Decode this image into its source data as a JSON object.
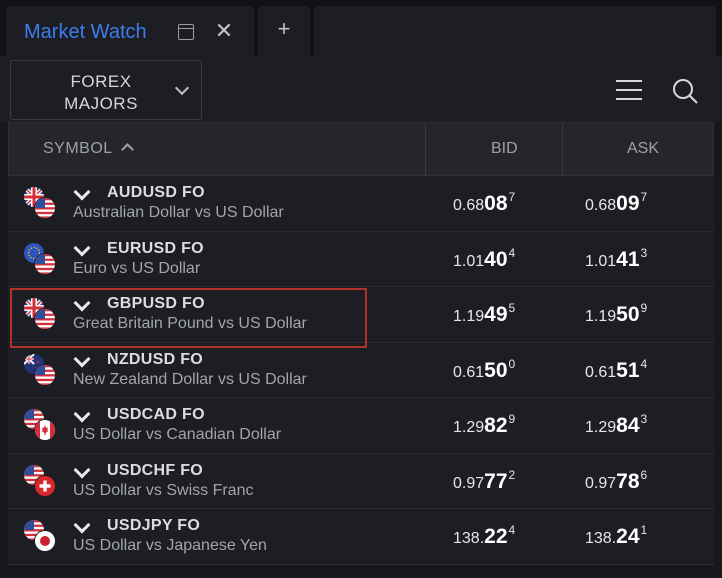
{
  "tabs": {
    "active_title": "Market Watch",
    "add_label": "+"
  },
  "toolbar": {
    "dropdown_line1": "FOREX",
    "dropdown_line2": "MAJORS"
  },
  "table": {
    "headers": {
      "symbol": "SYMBOL",
      "bid": "BID",
      "ask": "ASK"
    },
    "rows": [
      {
        "symbol": "AUDUSD FO",
        "description": "Australian Dollar vs US Dollar",
        "bid": {
          "pre": "0.68",
          "big": "08",
          "sup": "7"
        },
        "ask": {
          "pre": "0.68",
          "big": "09",
          "sup": "7"
        },
        "flags": [
          "uk",
          "us"
        ]
      },
      {
        "symbol": "EURUSD FO",
        "description": "Euro vs US Dollar",
        "bid": {
          "pre": "1.01",
          "big": "40",
          "sup": "4"
        },
        "ask": {
          "pre": "1.01",
          "big": "41",
          "sup": "3"
        },
        "flags": [
          "eu",
          "us"
        ]
      },
      {
        "symbol": "GBPUSD FO",
        "description": "Great Britain Pound vs US Dollar",
        "bid": {
          "pre": "1.19",
          "big": "49",
          "sup": "5"
        },
        "ask": {
          "pre": "1.19",
          "big": "50",
          "sup": "9"
        },
        "flags": [
          "uk",
          "us"
        ]
      },
      {
        "symbol": "NZDUSD FO",
        "description": "New Zealand Dollar vs US Dollar",
        "bid": {
          "pre": "0.61",
          "big": "50",
          "sup": "0"
        },
        "ask": {
          "pre": "0.61",
          "big": "51",
          "sup": "4"
        },
        "flags": [
          "nz",
          "us"
        ]
      },
      {
        "symbol": "USDCAD FO",
        "description": "US Dollar vs Canadian Dollar",
        "bid": {
          "pre": "1.29",
          "big": "82",
          "sup": "9"
        },
        "ask": {
          "pre": "1.29",
          "big": "84",
          "sup": "3"
        },
        "flags": [
          "us",
          "ca"
        ]
      },
      {
        "symbol": "USDCHF FO",
        "description": "US Dollar vs Swiss Franc",
        "bid": {
          "pre": "0.97",
          "big": "77",
          "sup": "2"
        },
        "ask": {
          "pre": "0.97",
          "big": "78",
          "sup": "6"
        },
        "flags": [
          "us",
          "ch"
        ]
      },
      {
        "symbol": "USDJPY FO",
        "description": "US Dollar vs Japanese Yen",
        "bid": {
          "pre": "138.",
          "big": "22",
          "sup": "4"
        },
        "ask": {
          "pre": "138.",
          "big": "24",
          "sup": "1"
        },
        "flags": [
          "us",
          "jp"
        ]
      }
    ]
  },
  "icons": {
    "popout": "popout-icon",
    "close": "close-icon",
    "menu": "menu-icon",
    "search": "search-icon",
    "sort": "sort-ascending-icon",
    "expand": "chevron-down-icon"
  },
  "colors": {
    "accent": "#3f7cf0",
    "highlight": "#b0312a",
    "background": "#1d1e23"
  }
}
